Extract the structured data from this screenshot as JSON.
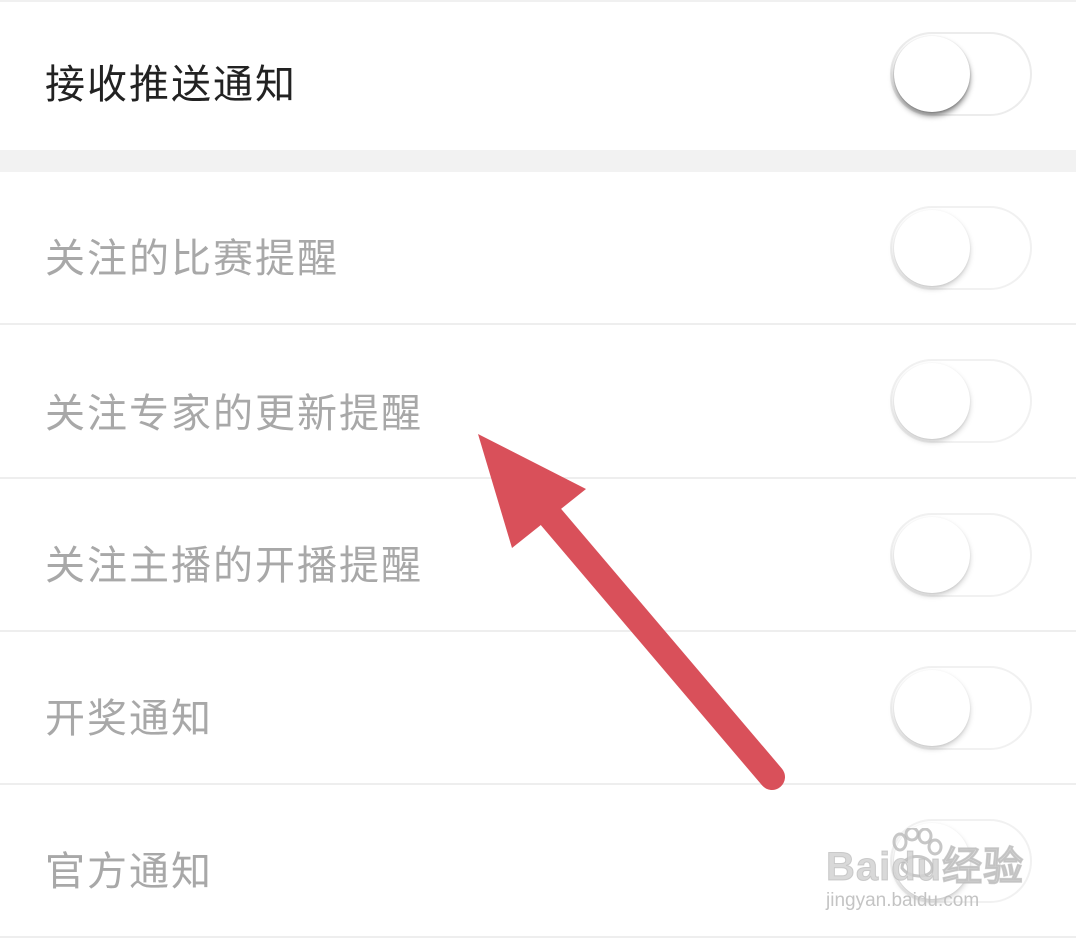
{
  "settings": {
    "master": {
      "label": "接收推送通知",
      "enabled": false
    },
    "items": [
      {
        "label": "关注的比赛提醒",
        "enabled": false
      },
      {
        "label": "关注专家的更新提醒",
        "enabled": false
      },
      {
        "label": "关注主播的开播提醒",
        "enabled": false
      },
      {
        "label": "开奖通知",
        "enabled": false
      },
      {
        "label": "官方通知",
        "enabled": false
      }
    ]
  },
  "annotation": {
    "arrow_color": "#d9505a"
  },
  "watermark": {
    "brand": "Baidu经验",
    "site": "jingyan.baidu.com"
  },
  "colors": {
    "master_text": "#222222",
    "disabled_text": "#a8a8a8",
    "divider": "#eeeeee",
    "section_gap": "#f2f2f2"
  }
}
